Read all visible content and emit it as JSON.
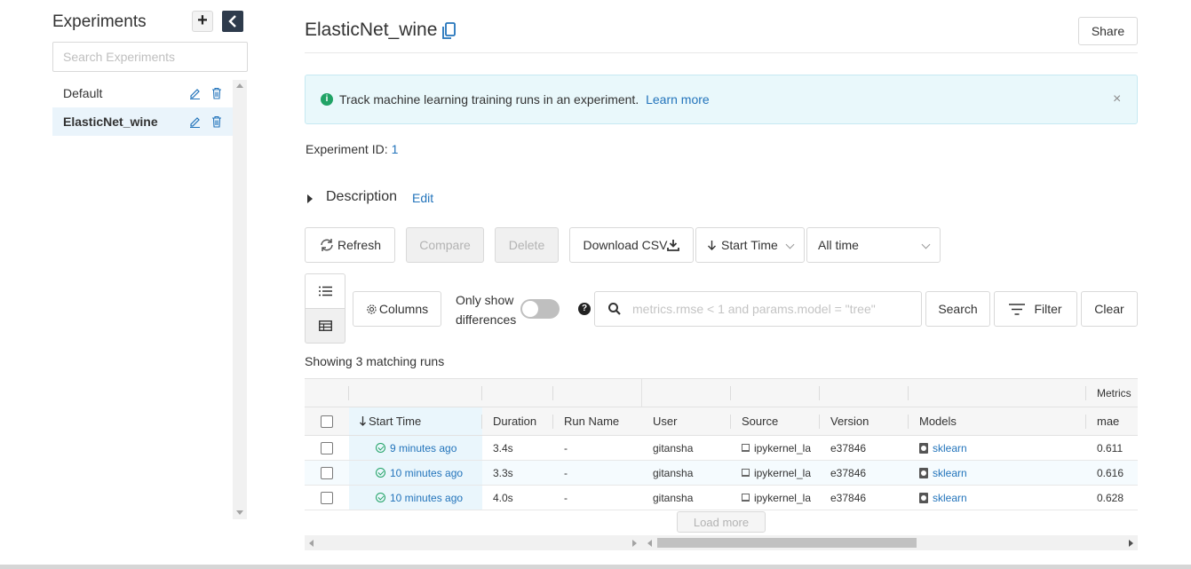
{
  "sidebar": {
    "title": "Experiments",
    "add_symbol": "+",
    "search_placeholder": "Search Experiments",
    "experiments": [
      {
        "name": "Default",
        "active": false
      },
      {
        "name": "ElasticNet_wine",
        "active": true
      }
    ]
  },
  "header": {
    "title": "ElasticNet_wine",
    "share_label": "Share"
  },
  "banner": {
    "icon_text": "i",
    "text": "Track machine learning training runs in an experiment.",
    "link": "Learn more",
    "close": "×"
  },
  "experiment": {
    "id_label": "Experiment ID:",
    "id_value": "1"
  },
  "description": {
    "label": "Description",
    "edit": "Edit"
  },
  "toolbar": {
    "refresh": "Refresh",
    "compare": "Compare",
    "delete": "Delete",
    "download_csv": "Download CSV",
    "sort_value": "Start Time",
    "time_value": "All time",
    "columns": "Columns",
    "only_show_differences": "Only show differences",
    "help_text": "?",
    "search_placeholder": "metrics.rmse < 1 and params.model = \"tree\"",
    "search": "Search",
    "filter": "Filter",
    "clear": "Clear"
  },
  "runs": {
    "showing": "Showing 3 matching runs",
    "group_header_metrics": "Metrics",
    "columns": [
      "Start Time",
      "Duration",
      "Run Name",
      "User",
      "Source",
      "Version",
      "Models",
      "mae"
    ],
    "rows": [
      {
        "start": "9 minutes ago",
        "duration": "3.4s",
        "run_name": "-",
        "user": "gitansha",
        "source": "ipykernel_la",
        "version": "e37846",
        "model": "sklearn",
        "mae": "0.611"
      },
      {
        "start": "10 minutes ago",
        "duration": "3.3s",
        "run_name": "-",
        "user": "gitansha",
        "source": "ipykernel_la",
        "version": "e37846",
        "model": "sklearn",
        "mae": "0.616"
      },
      {
        "start": "10 minutes ago",
        "duration": "4.0s",
        "run_name": "-",
        "user": "gitansha",
        "source": "ipykernel_la",
        "version": "e37846",
        "model": "sklearn",
        "mae": "0.628"
      }
    ],
    "load_more": "Load more"
  },
  "colors": {
    "accent": "#2374bb",
    "success": "#21a366",
    "banner_bg": "#e9f8fb",
    "sidebar_collapse": "#2e3b4c"
  }
}
